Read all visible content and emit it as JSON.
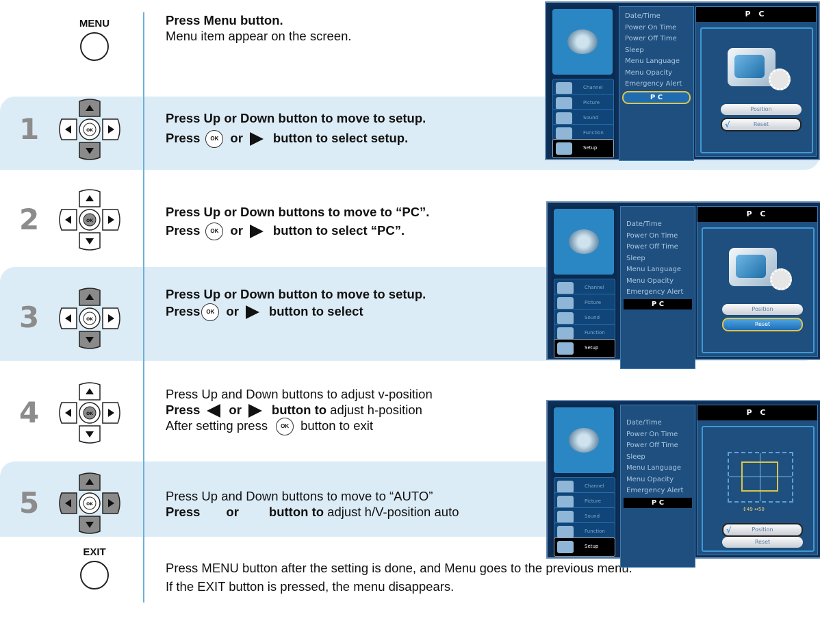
{
  "intro": {
    "button_label": "MENU",
    "line1": "Press Menu button.",
    "line2": "Menu item appear on the screen."
  },
  "steps": [
    {
      "number": "1",
      "line1": "Press Up or Down button to move to setup.",
      "line2_pre": "Press",
      "ok": "OK",
      "line2_or": "or",
      "line2_post": "button to select setup."
    },
    {
      "number": "2",
      "line1": "Press Up or Down buttons to move to “PC”.",
      "line2_pre": "Press",
      "ok": "OK",
      "line2_or": "or",
      "line2_post": "button to select “PC”."
    },
    {
      "number": "3",
      "line1": "Press Up or Down button to move to setup.",
      "line2_pre": "Press",
      "ok": "OK",
      "line2_or": "or",
      "line2_post": "button to select"
    },
    {
      "number": "4",
      "line1": "Press Up and Down buttons to adjust v-position",
      "line2_pre": "Press",
      "line2_or": "or",
      "line2_post_bold": "button to",
      "line2_post": " adjust h-position",
      "line3_pre": "After setting press",
      "ok": "OK",
      "line3_post": "button to exit"
    },
    {
      "number": "5",
      "line1": "Press Up and Down buttons to move to “AUTO”",
      "line2_pre": "Press",
      "line2_or": "or",
      "line2_post_bold": "button to",
      "line2_post": " adjust h/V-position auto"
    }
  ],
  "exit": {
    "button_label": "EXIT",
    "line1": "Press MENU button after the setting is done, and Menu goes to the previous menu.",
    "line2": "If the EXIT button is pressed, the menu disappears."
  },
  "dpad": {
    "ok_label": "OK"
  },
  "tv_menu": {
    "items": [
      "Date/Time",
      "Power On Time",
      "Power Off Time",
      "Sleep",
      "Menu Language",
      "Menu Opacity",
      "Emergency Alert",
      "P C"
    ],
    "title": "P C",
    "categories": [
      "Channel",
      "Picture",
      "Sound",
      "Function",
      "Setup"
    ],
    "buttons": [
      "Position",
      "Reset"
    ],
    "values": "↕49   ↔50",
    "colors": {
      "background": "#0d2f57",
      "panel": "#1f4f7e",
      "accent": "#3f9ad6",
      "highlight": "#e1c34b"
    }
  },
  "colors": {
    "band": "#dcecf6",
    "divider": "#6ab0dc",
    "step_number": "#8c8c8c"
  }
}
